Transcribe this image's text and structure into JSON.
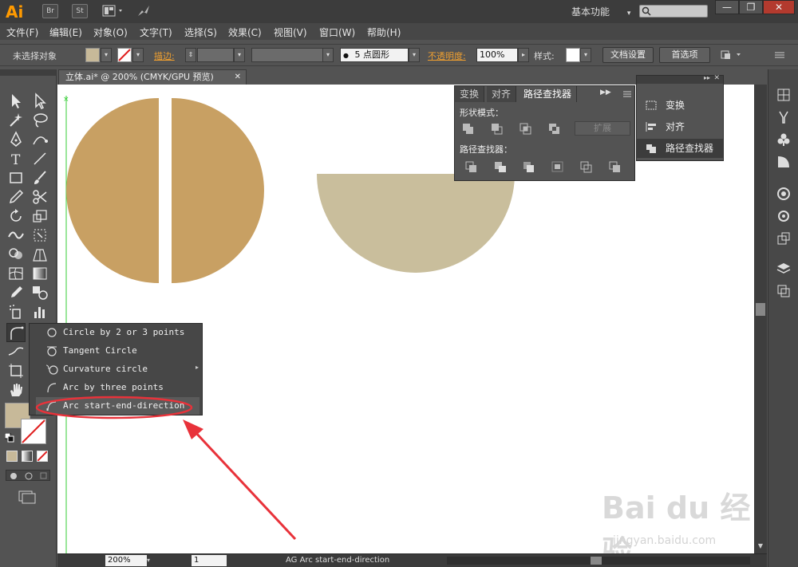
{
  "app": {
    "logo": "Ai",
    "btn_br": "Br",
    "btn_st": "St",
    "workspace": "基本功能",
    "workspace_arrow": "▾",
    "window_min": "—",
    "window_max": "❐",
    "window_close": "✕"
  },
  "menu": [
    "文件(F)",
    "编辑(E)",
    "对象(O)",
    "文字(T)",
    "选择(S)",
    "效果(C)",
    "视图(V)",
    "窗口(W)",
    "帮助(H)"
  ],
  "control": {
    "selection": "未选择对象",
    "stroke_label": "描边:",
    "brush_dot": "●",
    "brush_size": "5",
    "brush_name": "点圆形",
    "opacity_label": "不透明度:",
    "opacity_value": "100%",
    "style_label": "样式:",
    "doc_settings": "文档设置",
    "preferences": "首选项",
    "fill_color": "#c7b999"
  },
  "document": {
    "tab_title": "立体.ai* @ 200% (CMYK/GPU 预览)",
    "tab_close": "✕"
  },
  "shapes": {
    "split_circle_color": "#c8a063",
    "half_circle_color": "#c9be9c"
  },
  "pathfinder": {
    "tabs": [
      "变换",
      "对齐",
      "路径查找器"
    ],
    "shape_modes_label": "形状模式：",
    "pathfinder_label": "路径查找器：",
    "expand_button": "扩展"
  },
  "dock": {
    "items": [
      "变换",
      "对齐",
      "路径查找器"
    ]
  },
  "flyout": {
    "items": [
      "Circle by 2 or 3 points",
      "Tangent Circle",
      "Curvature circle",
      "Arc by three points",
      "Arc start-end-direction"
    ]
  },
  "status": {
    "zoom": "200%",
    "page": "1",
    "tool_name": "AG Arc start-end-direction"
  },
  "watermark": {
    "brand": "Bai du 经验",
    "url": "jingyan.baidu.com"
  },
  "annotation": {
    "color": "#e8323a"
  }
}
